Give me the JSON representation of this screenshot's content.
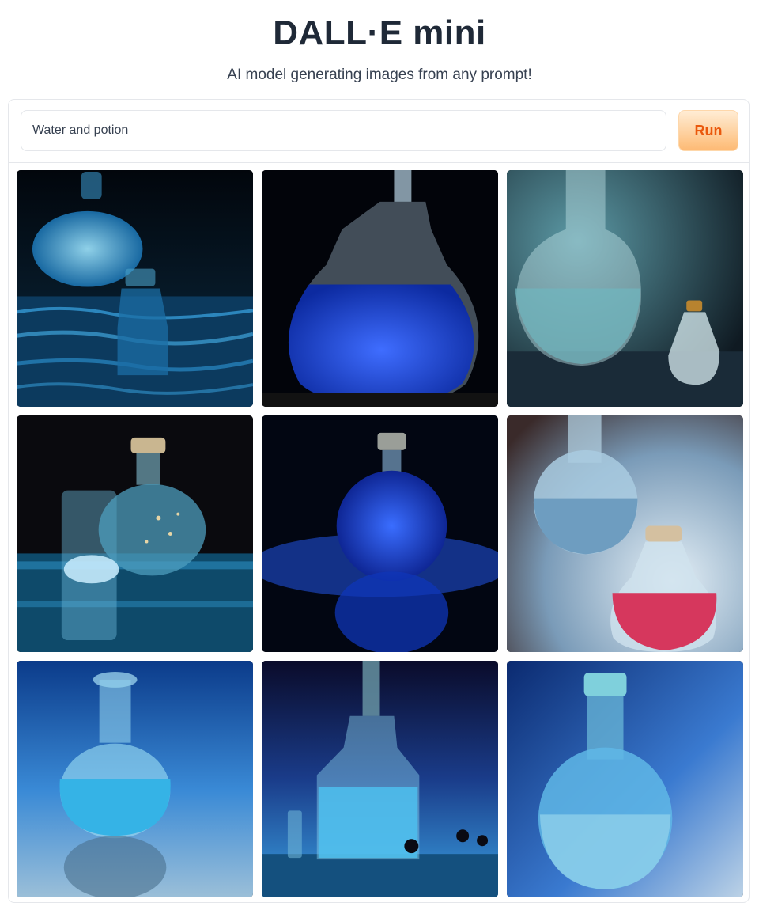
{
  "header": {
    "title": "DALL·E mini",
    "subtitle": "AI model generating images from any prompt!"
  },
  "prompt": {
    "value": "Water and potion",
    "run_label": "Run"
  },
  "gallery": {
    "images": [
      {
        "alt": "blue glass flask and bottle on rippling water"
      },
      {
        "alt": "carafe filled with deep blue liquid"
      },
      {
        "alt": "clear flask with cyan liquid and small bottle"
      },
      {
        "alt": "glass flask with bubbles beside beaker"
      },
      {
        "alt": "round flask with blue liquid and reflection"
      },
      {
        "alt": "flask with water and small flask with pink liquid"
      },
      {
        "alt": "light blue bulb flask on reflective surface"
      },
      {
        "alt": "tall bottle with cyan liquid and small vials"
      },
      {
        "alt": "round bottom flask with light blue liquid"
      }
    ]
  }
}
